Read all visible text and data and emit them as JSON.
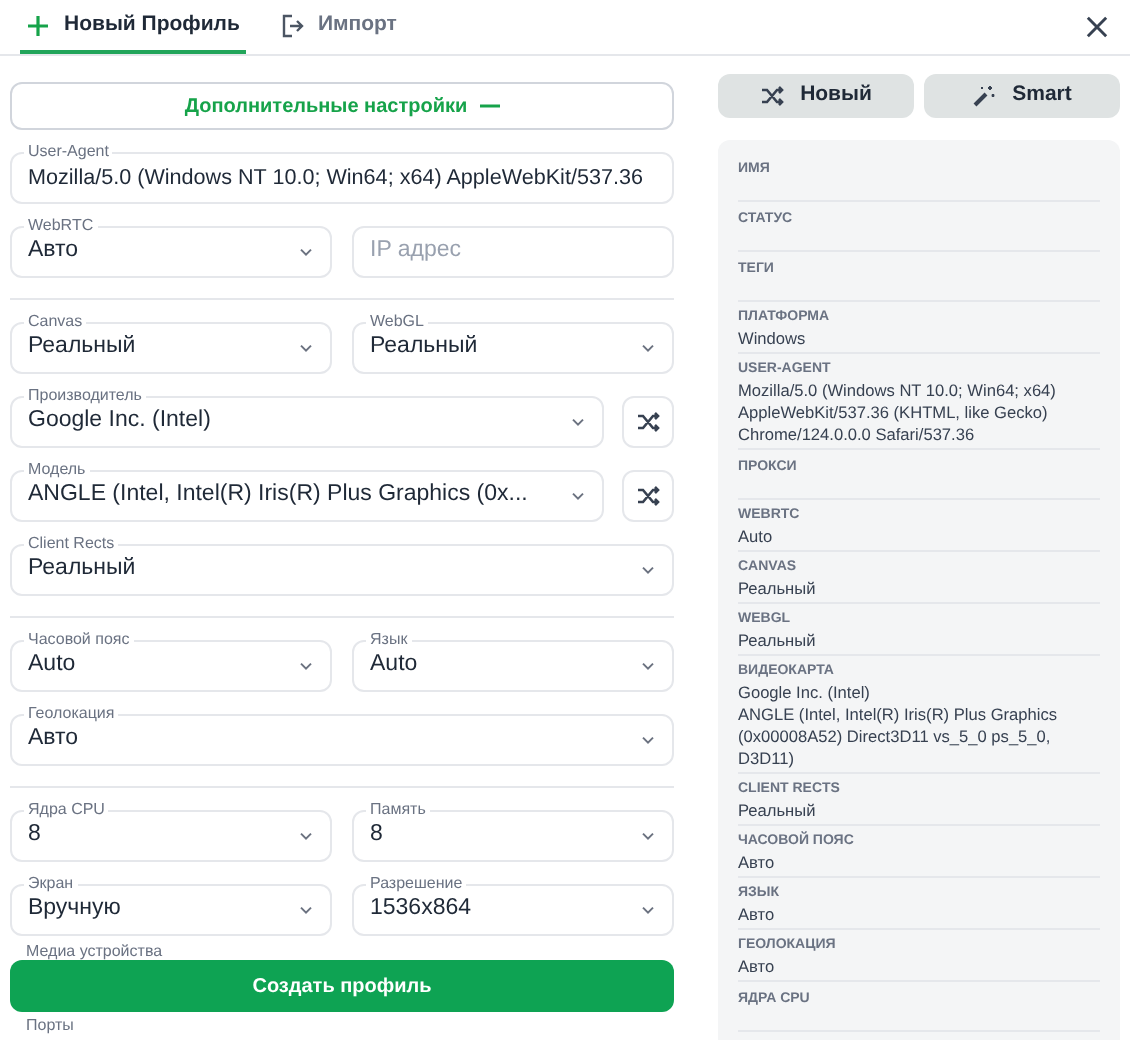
{
  "tabs": [
    {
      "label": "Новый Профиль",
      "selected": true
    },
    {
      "label": "Импорт",
      "selected": false
    }
  ],
  "advanced_toggle": {
    "label": "Дополнительные настройки",
    "expanded": true
  },
  "form": {
    "user_agent": {
      "label": "User-Agent",
      "value": "Mozilla/5.0 (Windows NT 10.0; Win64; x64) AppleWebKit/537.36"
    },
    "sections": [
      {
        "rows": [
          {
            "shuffle": false,
            "fields": [
              {
                "kind": "select",
                "label": "WebRTC",
                "value": "Авто"
              },
              {
                "kind": "input",
                "placeholder": "IP адрес"
              }
            ]
          }
        ]
      },
      {
        "rows": [
          {
            "shuffle": false,
            "fields": [
              {
                "kind": "select",
                "label": "Canvas",
                "value": "Реальный"
              },
              {
                "kind": "select",
                "label": "WebGL",
                "value": "Реальный"
              }
            ]
          },
          {
            "shuffle": true,
            "fields": [
              {
                "kind": "select",
                "label": "Производитель",
                "value": "Google Inc. (Intel)"
              }
            ]
          },
          {
            "shuffle": true,
            "fields": [
              {
                "kind": "select",
                "label": "Модель",
                "value": "ANGLE (Intel, Intel(R) Iris(R) Plus Graphics (0x..."
              }
            ]
          },
          {
            "shuffle": false,
            "fields": [
              {
                "kind": "select",
                "label": "Client Rects",
                "value": "Реальный"
              }
            ]
          }
        ]
      },
      {
        "rows": [
          {
            "shuffle": false,
            "fields": [
              {
                "kind": "select",
                "label": "Часовой пояс",
                "value": "Auto"
              },
              {
                "kind": "select",
                "label": "Язык",
                "value": "Auto"
              }
            ]
          },
          {
            "shuffle": false,
            "fields": [
              {
                "kind": "select",
                "label": "Геолокация",
                "value": "Авто"
              }
            ]
          }
        ]
      },
      {
        "rows": [
          {
            "shuffle": false,
            "fields": [
              {
                "kind": "select",
                "label": "Ядра CPU",
                "value": "8"
              },
              {
                "kind": "select",
                "label": "Память",
                "value": "8"
              }
            ]
          },
          {
            "shuffle": false,
            "fields": [
              {
                "kind": "select",
                "label": "Экран",
                "value": "Вручную"
              },
              {
                "kind": "select",
                "label": "Разрешение",
                "value": "1536x864"
              }
            ]
          }
        ]
      }
    ],
    "partial_labels": [
      "Медиа устройства",
      "Порты"
    ],
    "submit": "Создать профиль"
  },
  "actions": [
    {
      "label": "Новый"
    },
    {
      "label": "Smart"
    }
  ],
  "summary": [
    {
      "label": "ИМЯ"
    },
    {
      "label": "СТАТУС"
    },
    {
      "label": "ТЕГИ"
    },
    {
      "label": "ПЛАТФОРМА",
      "values": [
        "Windows"
      ]
    },
    {
      "label": "USER-AGENT",
      "values": [
        "Mozilla/5.0 (Windows NT 10.0; Win64; x64) AppleWebKit/537.36 (KHTML, like Gecko) Chrome/124.0.0.0 Safari/537.36"
      ]
    },
    {
      "label": "ПРОКСИ"
    },
    {
      "label": "WEBRTC",
      "values": [
        "Auto"
      ]
    },
    {
      "label": "CANVAS",
      "values": [
        "Реальный"
      ]
    },
    {
      "label": "WEBGL",
      "values": [
        "Реальный"
      ]
    },
    {
      "label": "ВИДЕОКАРТА",
      "values": [
        "Google Inc. (Intel)",
        "ANGLE (Intel, Intel(R) Iris(R) Plus Graphics (0x00008A52) Direct3D11 vs_5_0 ps_5_0, D3D11)"
      ]
    },
    {
      "label": "CLIENT RECTS",
      "values": [
        "Реальный"
      ]
    },
    {
      "label": "ЧАСОВОЙ ПОЯС",
      "values": [
        "Авто"
      ]
    },
    {
      "label": "ЯЗЫК",
      "values": [
        "Авто"
      ]
    },
    {
      "label": "ГЕОЛОКАЦИЯ",
      "values": [
        "Авто"
      ]
    },
    {
      "label": "ЯДРА CPU"
    }
  ]
}
